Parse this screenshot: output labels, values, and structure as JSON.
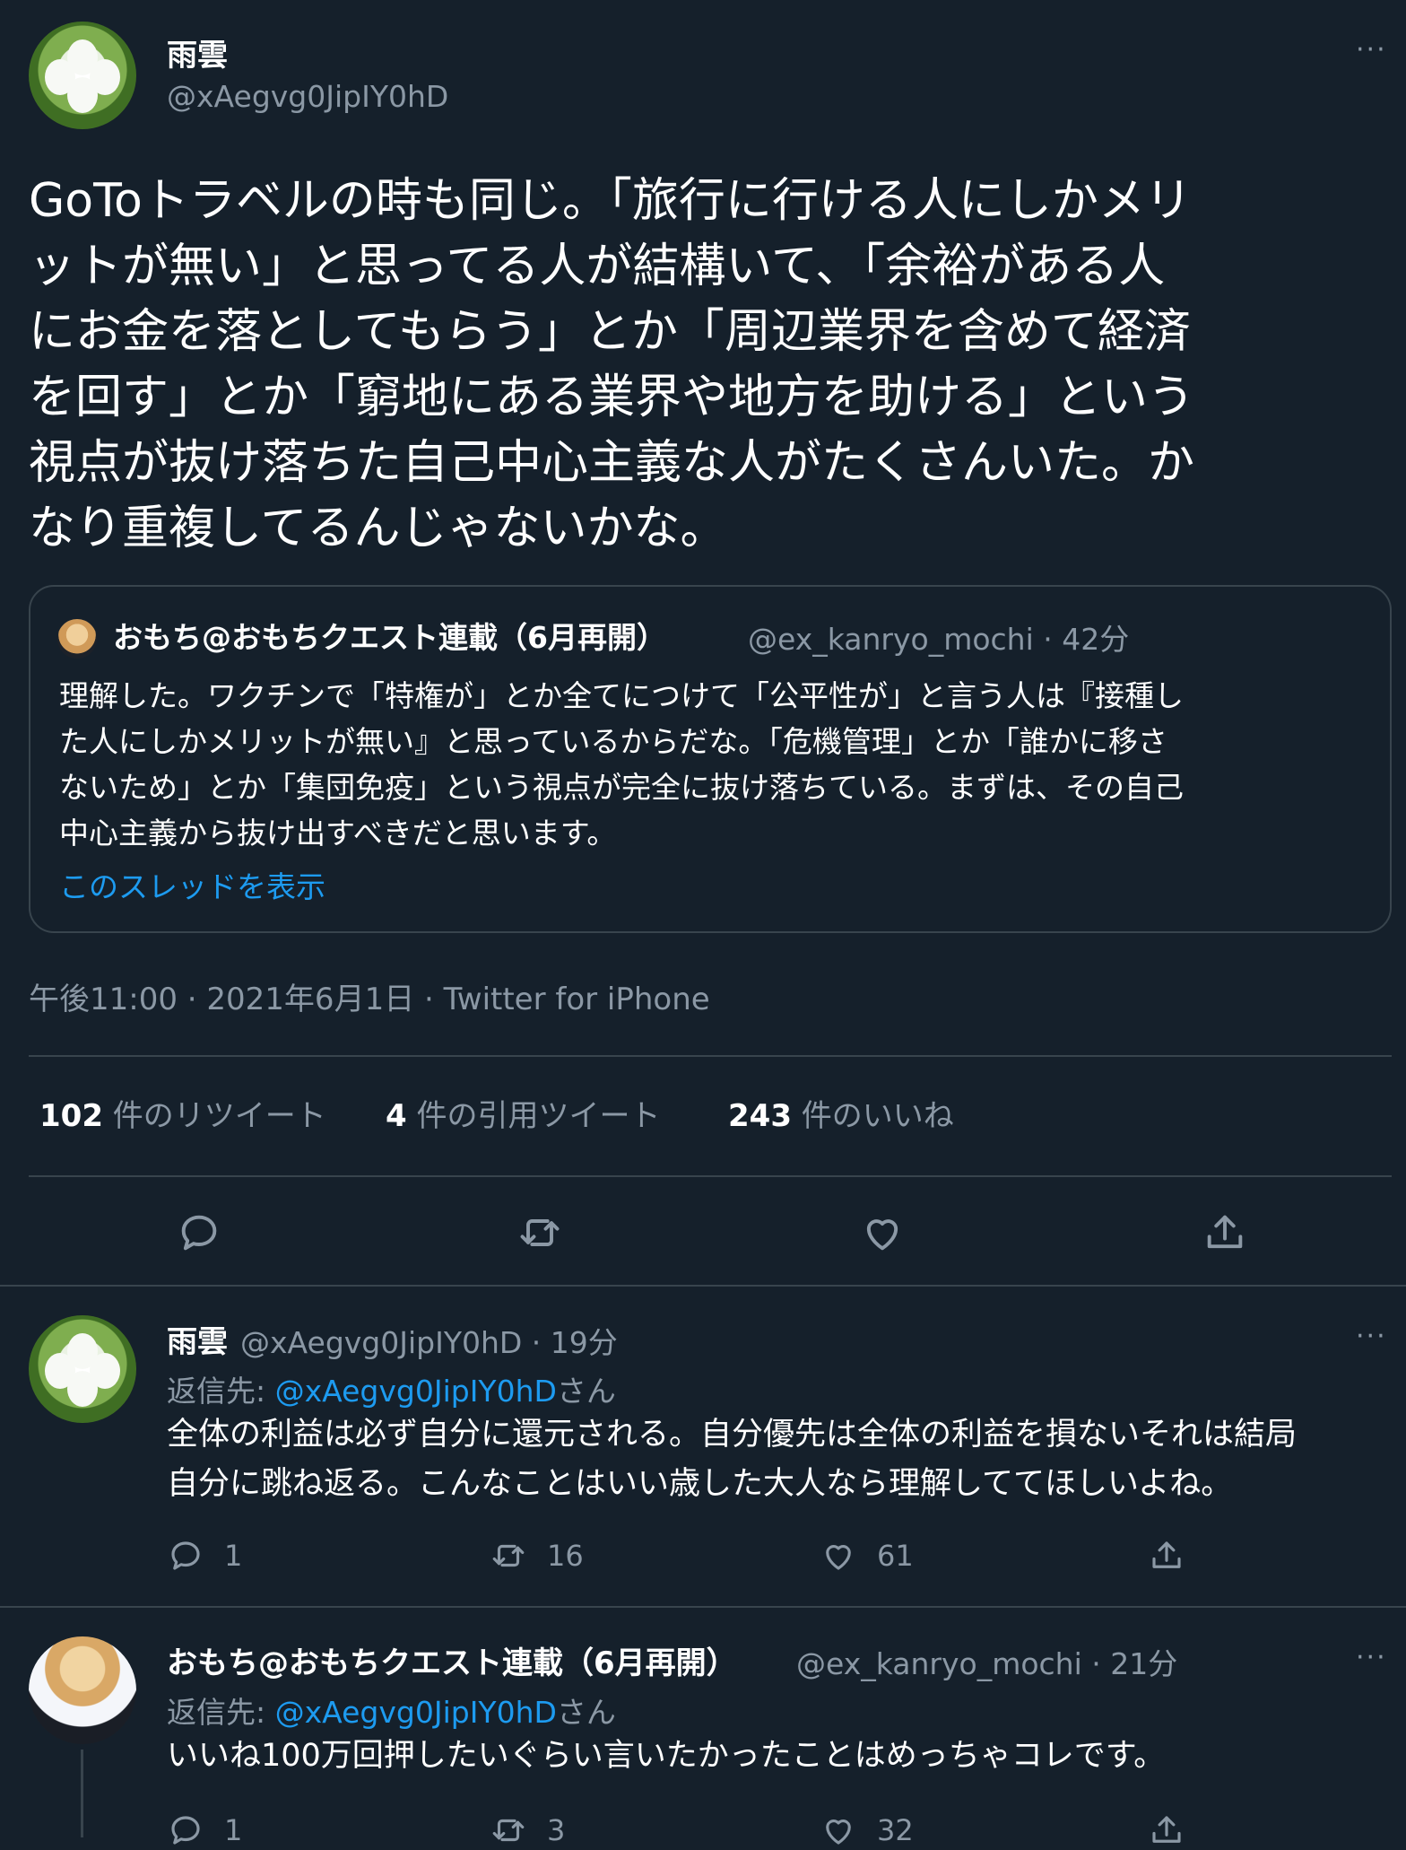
{
  "main_tweet": {
    "author_name": "雨雲",
    "author_handle": "@xAegvg0JipIY0hD",
    "more_label": "···",
    "text": "GoToトラベルの時も同じ。「旅行に行ける人にしかメリ\nットが無い」と思ってる人が結構いて、「余裕がある人\nにお金を落としてもらう」とか「周辺業界を含めて経済\nを回す」とか「窮地にある業界や地方を助ける」という\n視点が抜け落ちた自己中心主義な人がたくさんいた。か\nなり重複してるんじゃないかな。",
    "timestamp": "午後11:00 · 2021年6月1日 · Twitter for iPhone"
  },
  "quoted_tweet": {
    "author_name": "おもち@おもちクエスト連載（6月再開）",
    "meta": "@ex_kanryo_mochi · 42分",
    "text": "理解した。ワクチンで「特権が」とか全てにつけて「公平性が」と言う人は『接種し\nた人にしかメリットが無い』と思っているからだな。「危機管理」とか「誰かに移さ\nないため」とか「集団免疫」という視点が完全に抜け落ちている。まずは、その自己\n中心主義から抜け出すべきだと思います。",
    "show_thread_label": "このスレッドを表示"
  },
  "stats": {
    "retweets_count": "102",
    "retweets_label": "件のリツイート",
    "quotes_count": "4",
    "quotes_label": "件の引用ツイート",
    "likes_count": "243",
    "likes_label": "件のいいね"
  },
  "replies": [
    {
      "author_name": "雨雲",
      "meta": "@xAegvg0JipIY0hD · 19分",
      "reply_to_prefix": "返信先: ",
      "reply_to_handle": "@xAegvg0JipIY0hD",
      "reply_to_suffix": "さん",
      "text": "全体の利益は必ず自分に還元される。自分優先は全体の利益を損ないそれは結局\n自分に跳ね返る。こんなことはいい歳した大人なら理解しててほしいよね。",
      "reply_count": "1",
      "retweet_count": "16",
      "like_count": "61",
      "more_label": "···"
    },
    {
      "author_name": "おもち@おもちクエスト連載（6月再開）",
      "meta": "@ex_kanryo_mochi · 21分",
      "reply_to_prefix": "返信先: ",
      "reply_to_handle": "@xAegvg0JipIY0hD",
      "reply_to_suffix": "さん",
      "text": "いいね100万回押したいぐらい言いたかったことはめっちゃコレです。",
      "reply_count": "1",
      "retweet_count": "3",
      "like_count": "32",
      "more_label": "···"
    }
  ],
  "icons": [
    "reply-icon",
    "retweet-icon",
    "like-icon",
    "share-icon",
    "more-icon"
  ],
  "colors": {
    "background": "#15202b",
    "text": "#ffffff",
    "muted": "#8b98a5",
    "link": "#1d9bf0",
    "border": "#38444d"
  }
}
